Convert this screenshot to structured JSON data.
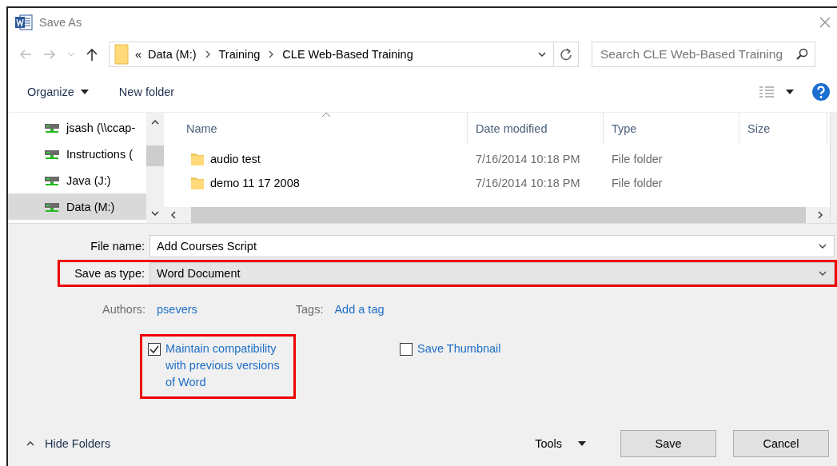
{
  "window": {
    "title": "Save As"
  },
  "address": {
    "overflow_marker": "«",
    "crumbs": [
      "Data (M:)",
      "Training",
      "CLE Web-Based Training"
    ]
  },
  "search": {
    "placeholder": "Search CLE Web-Based Training"
  },
  "toolbar": {
    "buttons": [
      {
        "label": "Organize",
        "dropdown": true
      },
      {
        "label": "New folder",
        "dropdown": false
      }
    ]
  },
  "sidebar": {
    "items": [
      {
        "label": "jsash (\\\\ccap-",
        "selected": false
      },
      {
        "label": "Instructions (",
        "selected": false
      },
      {
        "label": "Java (J:)",
        "selected": false
      },
      {
        "label": "Data (M:)",
        "selected": true
      }
    ]
  },
  "file_list": {
    "columns": [
      "Name",
      "Date modified",
      "Type",
      "Size"
    ],
    "rows": [
      {
        "name": "audio test",
        "date_modified": "7/16/2014 10:18 PM",
        "type": "File folder"
      },
      {
        "name": "demo 11 17 2008",
        "date_modified": "7/16/2014 10:18 PM",
        "type": "File folder"
      }
    ]
  },
  "form": {
    "fields": [
      {
        "label": "File name:",
        "value": "Add Courses Script",
        "kind": "text",
        "highlighted": false
      },
      {
        "label": "Save as type:",
        "value": "Word Document",
        "kind": "select",
        "highlighted": true
      }
    ],
    "meta": [
      {
        "label": "Authors:",
        "value": "psevers"
      },
      {
        "label": "Tags:",
        "value": "Add a tag"
      }
    ],
    "options": [
      {
        "label": "Maintain compatibility with previous versions of Word",
        "checked": true,
        "highlighted": true
      },
      {
        "label": "Save Thumbnail",
        "checked": false,
        "highlighted": false
      }
    ]
  },
  "footer": {
    "hide_folders": "Hide Folders",
    "tools": "Tools",
    "buttons": [
      "Save",
      "Cancel"
    ]
  }
}
